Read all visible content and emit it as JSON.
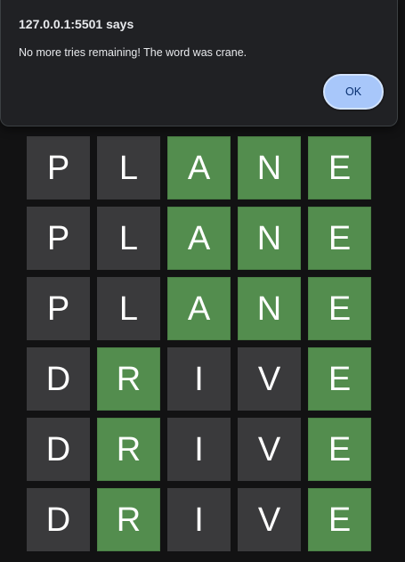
{
  "dialog": {
    "title": "127.0.0.1:5501 says",
    "message": "No more tries remaining! The word was crane.",
    "ok_label": "OK"
  },
  "board": {
    "rows": [
      [
        {
          "letter": "P",
          "state": "absent"
        },
        {
          "letter": "L",
          "state": "absent"
        },
        {
          "letter": "A",
          "state": "correct"
        },
        {
          "letter": "N",
          "state": "correct"
        },
        {
          "letter": "E",
          "state": "correct"
        }
      ],
      [
        {
          "letter": "P",
          "state": "absent"
        },
        {
          "letter": "L",
          "state": "absent"
        },
        {
          "letter": "A",
          "state": "correct"
        },
        {
          "letter": "N",
          "state": "correct"
        },
        {
          "letter": "E",
          "state": "correct"
        }
      ],
      [
        {
          "letter": "P",
          "state": "absent"
        },
        {
          "letter": "L",
          "state": "absent"
        },
        {
          "letter": "A",
          "state": "correct"
        },
        {
          "letter": "N",
          "state": "correct"
        },
        {
          "letter": "E",
          "state": "correct"
        }
      ],
      [
        {
          "letter": "D",
          "state": "absent"
        },
        {
          "letter": "R",
          "state": "correct"
        },
        {
          "letter": "I",
          "state": "absent"
        },
        {
          "letter": "V",
          "state": "absent"
        },
        {
          "letter": "E",
          "state": "correct"
        }
      ],
      [
        {
          "letter": "D",
          "state": "absent"
        },
        {
          "letter": "R",
          "state": "correct"
        },
        {
          "letter": "I",
          "state": "absent"
        },
        {
          "letter": "V",
          "state": "absent"
        },
        {
          "letter": "E",
          "state": "correct"
        }
      ],
      [
        {
          "letter": "D",
          "state": "absent"
        },
        {
          "letter": "R",
          "state": "correct"
        },
        {
          "letter": "I",
          "state": "absent"
        },
        {
          "letter": "V",
          "state": "absent"
        },
        {
          "letter": "E",
          "state": "correct"
        }
      ]
    ]
  },
  "colors": {
    "background": "#121213",
    "absent": "#3a3a3c",
    "correct": "#538d4e",
    "dialog_bg": "#202124",
    "ok_button": "#a8c7fa"
  }
}
